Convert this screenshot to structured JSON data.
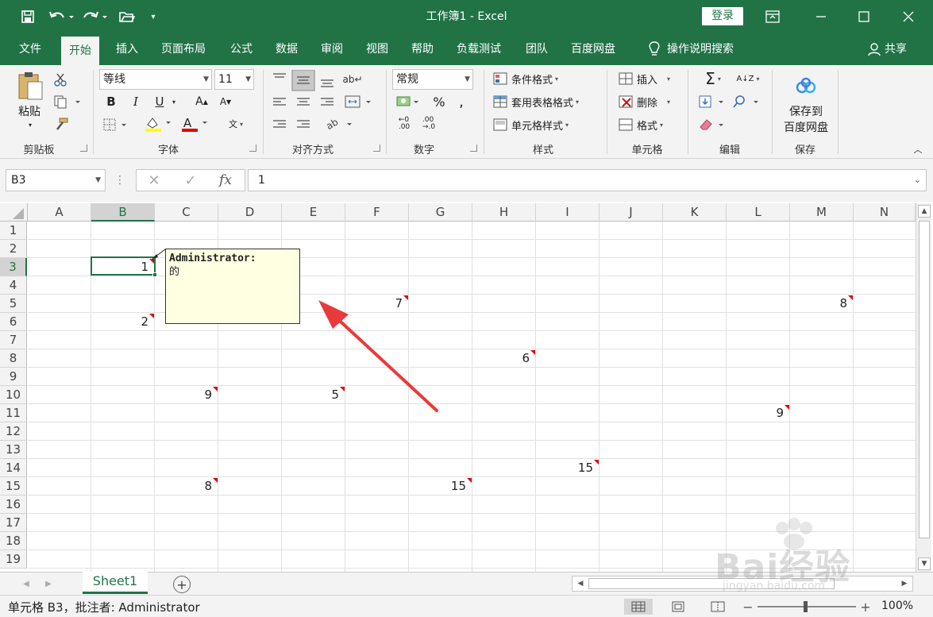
{
  "window": {
    "title": "工作簿1 - Excel",
    "login_label": "登录",
    "accent_color": "#217346"
  },
  "quick_access": [
    "save-icon",
    "undo-icon",
    "redo-icon",
    "open-folder-icon",
    "customize-icon"
  ],
  "tabs": [
    {
      "label": "文件"
    },
    {
      "label": "开始"
    },
    {
      "label": "插入"
    },
    {
      "label": "页面布局"
    },
    {
      "label": "公式"
    },
    {
      "label": "数据"
    },
    {
      "label": "审阅"
    },
    {
      "label": "视图"
    },
    {
      "label": "帮助"
    },
    {
      "label": "负载测试"
    },
    {
      "label": "团队"
    },
    {
      "label": "百度网盘"
    }
  ],
  "tell_me": "操作说明搜索",
  "share_label": "共享",
  "ribbon": {
    "clipboard": {
      "paste_label": "粘贴",
      "group_label": "剪贴板"
    },
    "font": {
      "font_name": "等线",
      "font_size": "11",
      "group_label": "字体",
      "bold": "B",
      "italic": "I",
      "underline": "U"
    },
    "alignment": {
      "group_label": "对齐方式"
    },
    "number": {
      "format": "常规",
      "group_label": "数字"
    },
    "styles": {
      "conditional": "条件格式",
      "table_format": "套用表格格式",
      "cell_styles": "单元格样式",
      "group_label": "样式"
    },
    "cells": {
      "insert": "插入",
      "delete": "删除",
      "format": "格式",
      "group_label": "单元格"
    },
    "editing": {
      "group_label": "编辑"
    },
    "save": {
      "label_line1": "保存到",
      "label_line2": "百度网盘",
      "group_label": "保存"
    }
  },
  "formula_bar": {
    "name_box": "B3",
    "formula": "1"
  },
  "sheet": {
    "columns": [
      "A",
      "B",
      "C",
      "D",
      "E",
      "F",
      "G",
      "H",
      "I",
      "J",
      "K",
      "L",
      "M",
      "N"
    ],
    "rows": [
      "1",
      "2",
      "3",
      "4",
      "5",
      "6",
      "7",
      "8",
      "9",
      "10",
      "11",
      "12",
      "13",
      "14",
      "15",
      "16",
      "17",
      "18",
      "19"
    ],
    "selected_cell": "B3",
    "cells": [
      {
        "ref": "B3",
        "value": "1"
      },
      {
        "ref": "B6",
        "value": "2"
      },
      {
        "ref": "F5",
        "value": "7"
      },
      {
        "ref": "M5",
        "value": "8"
      },
      {
        "ref": "H8",
        "value": "6"
      },
      {
        "ref": "C10",
        "value": "9"
      },
      {
        "ref": "E10",
        "value": "5"
      },
      {
        "ref": "L11",
        "value": "9"
      },
      {
        "ref": "I14",
        "value": "15"
      },
      {
        "ref": "C15",
        "value": "8"
      },
      {
        "ref": "G15",
        "value": "15"
      }
    ],
    "comment": {
      "author": "Administrator:",
      "text": "的"
    }
  },
  "sheet_tabs": [
    {
      "label": "Sheet1"
    }
  ],
  "status": {
    "text": "单元格 B3，批注者: Administrator",
    "zoom": "100%"
  },
  "watermark": {
    "text": "Bai经验",
    "url": "jingyan.baidu.com"
  }
}
